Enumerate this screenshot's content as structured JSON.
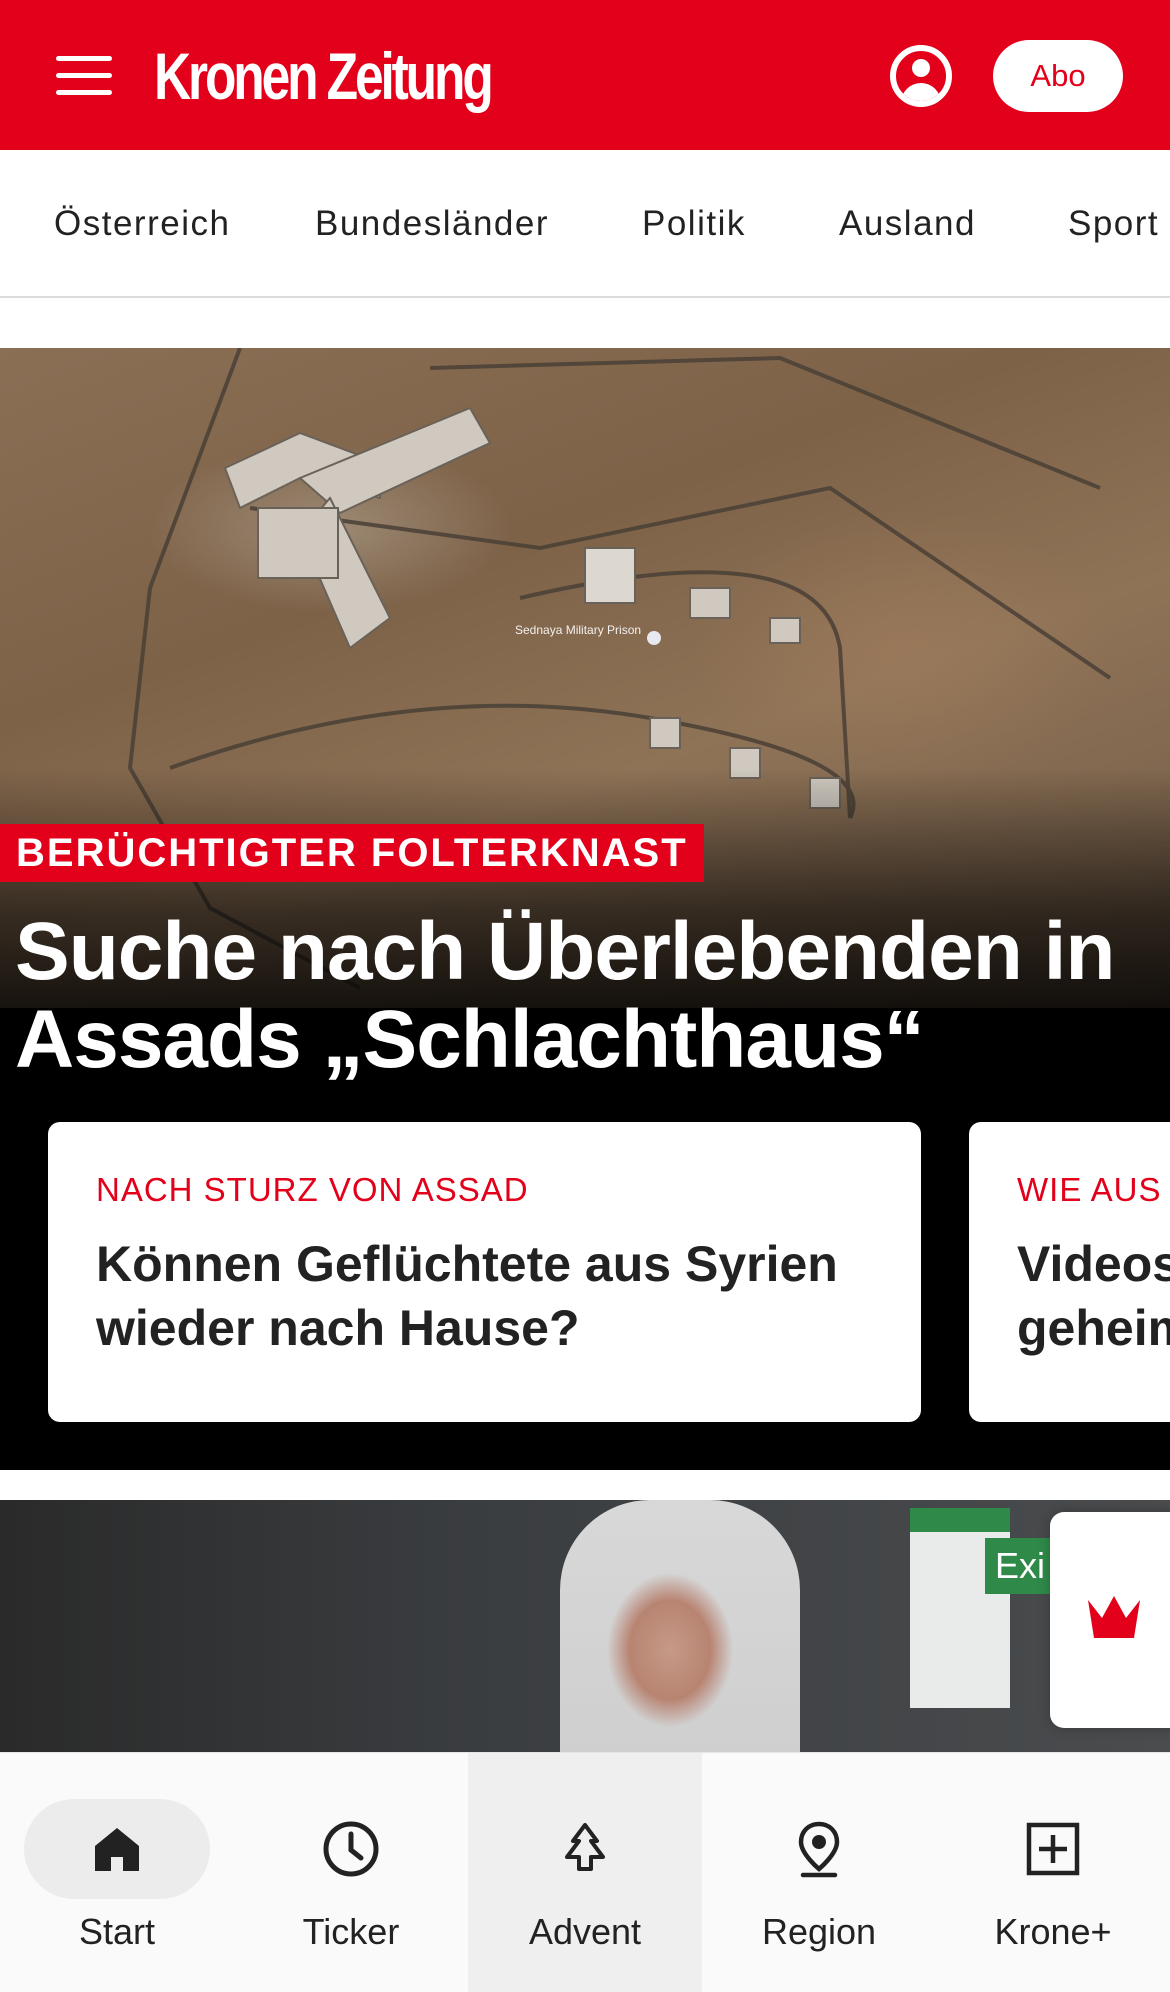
{
  "header": {
    "brand": "Kronen Zeitung",
    "abo_label": "Abo",
    "brand_color": "#e2001a"
  },
  "nav": {
    "items": [
      {
        "label": "Österreich"
      },
      {
        "label": "Bundesländer"
      },
      {
        "label": "Politik"
      },
      {
        "label": "Ausland"
      },
      {
        "label": "Sport"
      }
    ]
  },
  "hero": {
    "kicker": "BERÜCHTIGTER FOLTERKNAST",
    "headline": "Suche nach Überlebenden in Assads „Schlachthaus“",
    "image_caption": "Sednaya Military Prison",
    "cards": [
      {
        "kicker": "NACH STURZ VON ASSAD",
        "title_line1": "Können Geflüchtete aus Syrien",
        "title_line2": "wieder nach Hause?"
      },
      {
        "kicker": "WIE AUS",
        "title_line1": "Videos",
        "title_line2": "geheim"
      }
    ]
  },
  "teaser2": {
    "sign_text": "Exi",
    "sign_top": "open"
  },
  "bottom_nav": {
    "items": [
      {
        "label": "Start",
        "icon": "home-icon",
        "active": true
      },
      {
        "label": "Ticker",
        "icon": "clock-icon"
      },
      {
        "label": "Advent",
        "icon": "tree-icon",
        "highlighted": true
      },
      {
        "label": "Region",
        "icon": "location-pin-icon"
      },
      {
        "label": "Krone+",
        "icon": "plus-box-icon"
      }
    ]
  }
}
